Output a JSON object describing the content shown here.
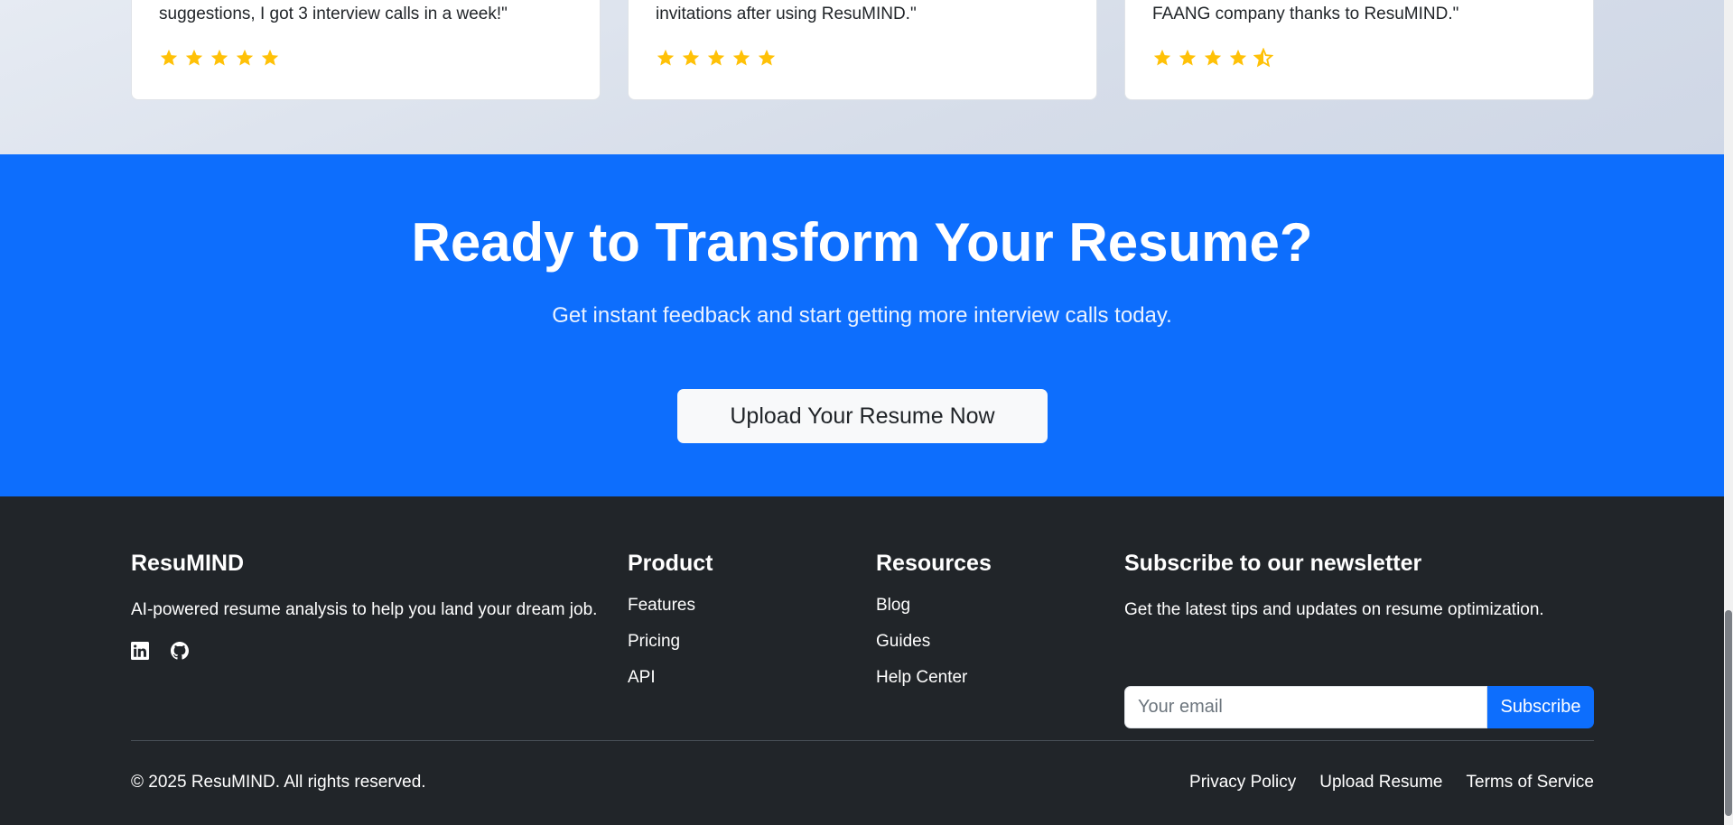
{
  "testimonials": [
    {
      "quote": "suggestions, I got 3 interview calls in a week!\"",
      "rating": 5
    },
    {
      "quote": "invitations after using ResuMIND.\"",
      "rating": 5
    },
    {
      "quote": "FAANG company thanks to ResuMIND.\"",
      "rating": 4.5
    }
  ],
  "cta": {
    "title": "Ready to Transform Your Resume?",
    "subtitle": "Get instant feedback and start getting more interview calls today.",
    "button_label": "Upload Your Resume Now"
  },
  "footer": {
    "brand": {
      "name": "ResuMIND",
      "description": "AI-powered resume analysis to help you land your dream job.",
      "social_icons": [
        "linkedin-icon",
        "github-icon"
      ]
    },
    "product": {
      "heading": "Product",
      "links": [
        "Features",
        "Pricing",
        "API"
      ]
    },
    "resources": {
      "heading": "Resources",
      "links": [
        "Blog",
        "Guides",
        "Help Center"
      ]
    },
    "newsletter": {
      "heading": "Subscribe to our newsletter",
      "description": "Get the latest tips and updates on resume optimization.",
      "email_placeholder": "Your email",
      "email_value": "",
      "button_label": "Subscribe"
    },
    "copyright": "© 2025 ResuMIND. All rights reserved.",
    "legal_links": [
      "Privacy Policy",
      "Upload Resume",
      "Terms of Service"
    ]
  },
  "colors": {
    "primary": "#0d6efd",
    "footer_bg": "#212529",
    "star": "#ffc107"
  }
}
